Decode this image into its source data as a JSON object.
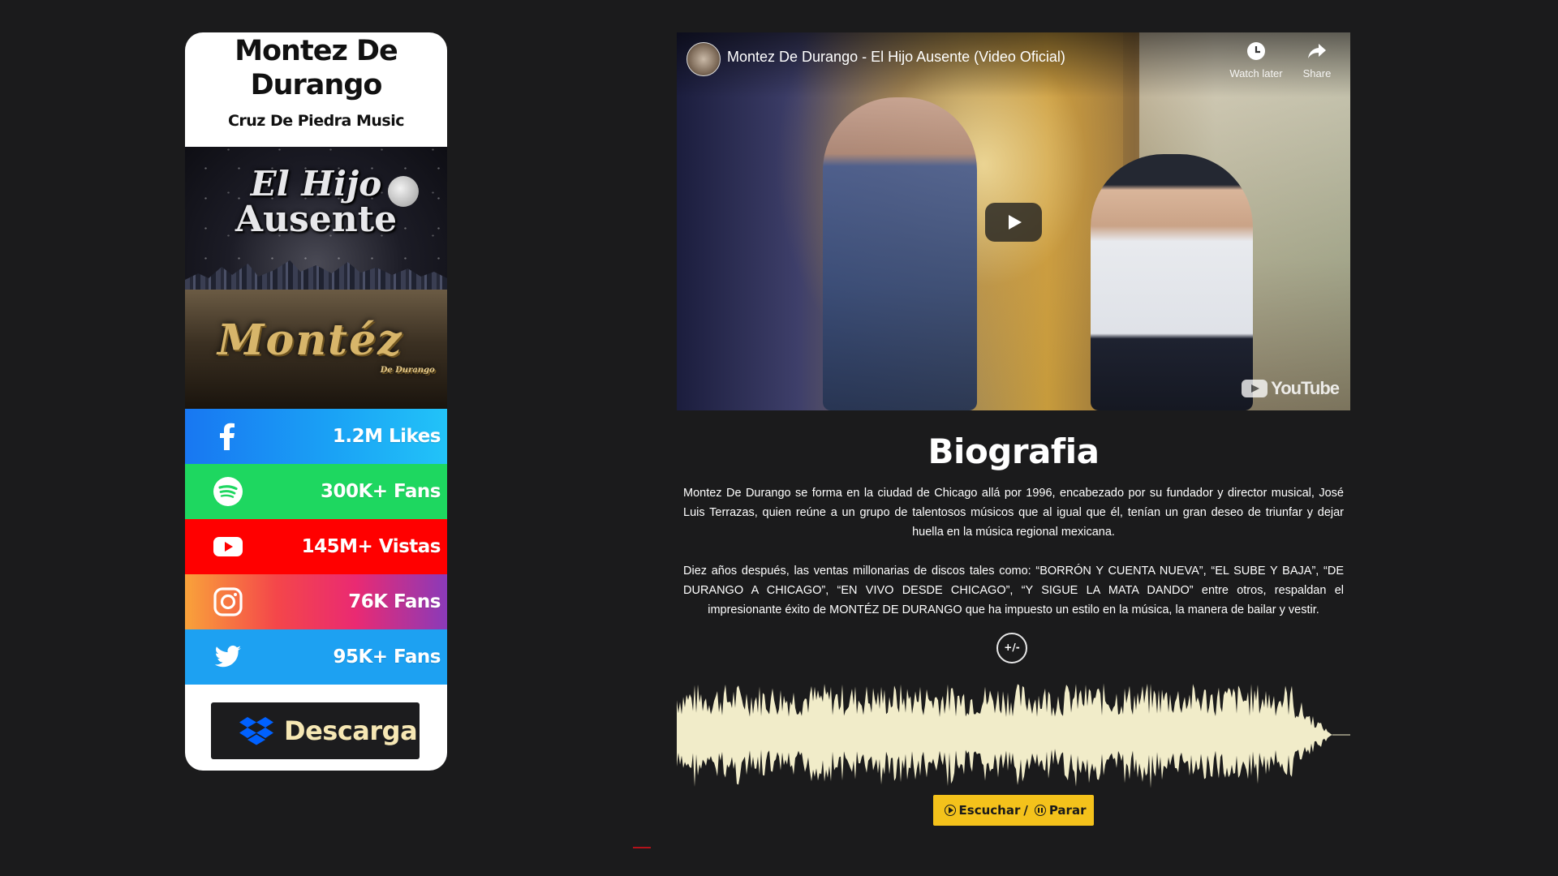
{
  "card": {
    "artist": "Montez De Durango",
    "label": "Cruz De Piedra Music",
    "cover": {
      "title_line1": "El Hijo",
      "title_line2": "Ausente",
      "brand": "Montéz",
      "brand_sub": "De Durango"
    },
    "social": [
      {
        "network": "facebook",
        "icon": "facebook-icon",
        "value": "1.2M Likes",
        "color": "#1877f2"
      },
      {
        "network": "spotify",
        "icon": "spotify-icon",
        "value": "300K+ Fans",
        "color": "#1ed760"
      },
      {
        "network": "youtube",
        "icon": "youtube-icon",
        "value": "145M+ Vistas",
        "color": "#ff0000"
      },
      {
        "network": "instagram",
        "icon": "instagram-icon",
        "value": "76K Fans",
        "color": "#e1306c"
      },
      {
        "network": "twitter",
        "icon": "twitter-icon",
        "value": "95K+ Fans",
        "color": "#1da1f2"
      }
    ],
    "download": {
      "label": "Descarga",
      "icon": "dropbox-icon"
    }
  },
  "video": {
    "title": "Montez De Durango - El Hijo Ausente (Video Oficial)",
    "watch_later": "Watch later",
    "share": "Share",
    "logo": "YouTube"
  },
  "bio": {
    "title": "Biografia",
    "p1": "Montez De Durango se forma en la ciudad de Chicago allá por 1996, encabezado por su fundador y director musical, José Luis Terrazas, quien reúne a un grupo de talentosos músicos que al igual que él, tenían un gran deseo de triunfar y dejar huella en la música regional mexicana.",
    "p2": "Diez años después, las ventas millonarias de discos tales como: “BORRÓN Y CUENTA NUEVA”, “EL SUBE Y BAJA”, “DE DURANGO A CHICAGO”, “EN VIVO DESDE CHICAGO”, “Y SIGUE LA MATA DANDO” entre otros, respaldan el impresionante éxito de MONTÉZ DE DURANGO que ha impuesto un estilo en la música, la manera de bailar y vestir.",
    "toggle": "+/-"
  },
  "player": {
    "listen": "Escuchar",
    "separator": "/",
    "stop": "Parar",
    "wave_color": "#f1ecc9",
    "button_color": "#f4c21b"
  }
}
